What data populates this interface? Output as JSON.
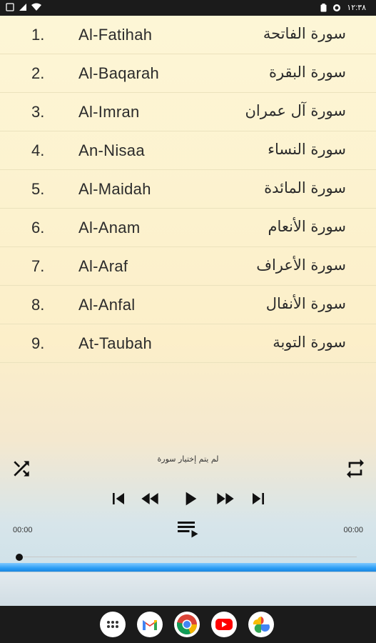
{
  "status": {
    "time": "١٢:٣٨"
  },
  "surahs": [
    {
      "num": "1.",
      "en": "Al-Fatihah",
      "ar": "سورة الفاتحة"
    },
    {
      "num": "2.",
      "en": "Al-Baqarah",
      "ar": "سورة البقرة"
    },
    {
      "num": "3.",
      "en": "Al-Imran",
      "ar": "سورة آل عمران"
    },
    {
      "num": "4.",
      "en": "An-Nisaa",
      "ar": "سورة النساء"
    },
    {
      "num": "5.",
      "en": "Al-Maidah",
      "ar": "سورة المائدة"
    },
    {
      "num": "6.",
      "en": "Al-Anam",
      "ar": "سورة الأنعام"
    },
    {
      "num": "7.",
      "en": "Al-Araf",
      "ar": "سورة الأعراف"
    },
    {
      "num": "8.",
      "en": "Al-Anfal",
      "ar": "سورة الأنفال"
    },
    {
      "num": "9.",
      "en": "At-Taubah",
      "ar": "سورة التوبة"
    }
  ],
  "player": {
    "status_text": "لم يتم إختيار سورة",
    "time_elapsed": "00:00",
    "time_total": "00:00",
    "progress": 0
  },
  "icons": {
    "shuffle": "shuffle-icon",
    "repeat": "repeat-icon",
    "skip_previous": "skip-previous-icon",
    "rewind": "rewind-icon",
    "play": "play-icon",
    "fast_forward": "fast-forward-icon",
    "skip_next": "skip-next-icon",
    "queue": "playlist-icon"
  },
  "dock": [
    "app-drawer",
    "gmail",
    "chrome",
    "youtube",
    "photos"
  ],
  "colors": {
    "accent_bar": "#2b9df5",
    "text": "#2b2b2b"
  }
}
